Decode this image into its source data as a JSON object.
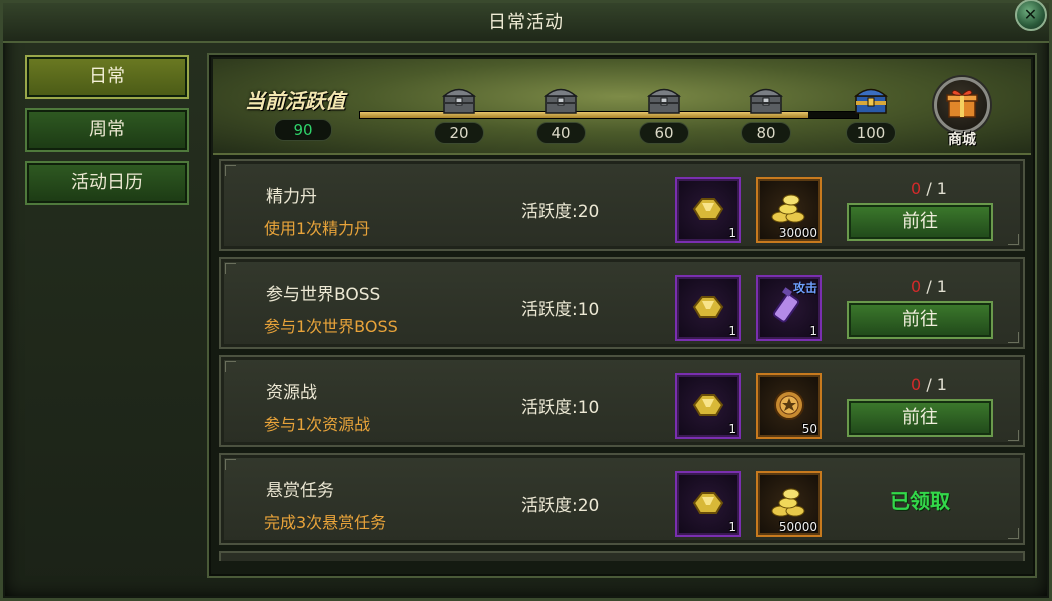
{
  "window": {
    "title": "日常活动",
    "close_icon": "close-icon"
  },
  "sidebar": {
    "tabs": [
      {
        "label": "日常",
        "active": true
      },
      {
        "label": "周常",
        "active": false
      },
      {
        "label": "活动日历",
        "active": false
      }
    ]
  },
  "header": {
    "activity_title": "当前活跃值",
    "activity_value": "90",
    "progress_fraction": 0.9,
    "milestones": [
      "20",
      "40",
      "60",
      "80",
      "100"
    ],
    "shop_label": "商城"
  },
  "tasks": [
    {
      "name": "精力丹",
      "desc": "使用1次精力丹",
      "points": "活跃度:20",
      "rewards": [
        {
          "icon": "gold-ingot-icon",
          "qty": "1",
          "frame": "purple"
        },
        {
          "icon": "gold-coins-icon",
          "qty": "30000",
          "frame": "orange"
        }
      ],
      "progress_current": "0",
      "progress_total": "/ 1",
      "action": "前往"
    },
    {
      "name": "参与世界BOSS",
      "desc": "参与1次世界BOSS",
      "points": "活跃度:10",
      "rewards": [
        {
          "icon": "gold-ingot-icon",
          "qty": "1",
          "frame": "purple"
        },
        {
          "icon": "attack-potion-icon",
          "qty": "1",
          "frame": "purple",
          "tag": "攻击"
        }
      ],
      "progress_current": "0",
      "progress_total": "/ 1",
      "action": "前往"
    },
    {
      "name": "资源战",
      "desc": "参与1次资源战",
      "points": "活跃度:10",
      "rewards": [
        {
          "icon": "gold-ingot-icon",
          "qty": "1",
          "frame": "purple"
        },
        {
          "icon": "medal-coin-icon",
          "qty": "50",
          "frame": "orange"
        }
      ],
      "progress_current": "0",
      "progress_total": "/ 1",
      "action": "前往"
    },
    {
      "name": "悬赏任务",
      "desc": "完成3次悬赏任务",
      "points": "活跃度:20",
      "rewards": [
        {
          "icon": "gold-ingot-icon",
          "qty": "1",
          "frame": "purple"
        },
        {
          "icon": "gold-coins-icon",
          "qty": "50000",
          "frame": "orange"
        }
      ],
      "status": "已领取"
    }
  ],
  "colors": {
    "accent_green": "#33d84a",
    "progress_red": "#d22a2a",
    "desc_orange": "#e8a33a",
    "frame_purple": "#7a2fb0",
    "frame_orange": "#c87a1e"
  }
}
